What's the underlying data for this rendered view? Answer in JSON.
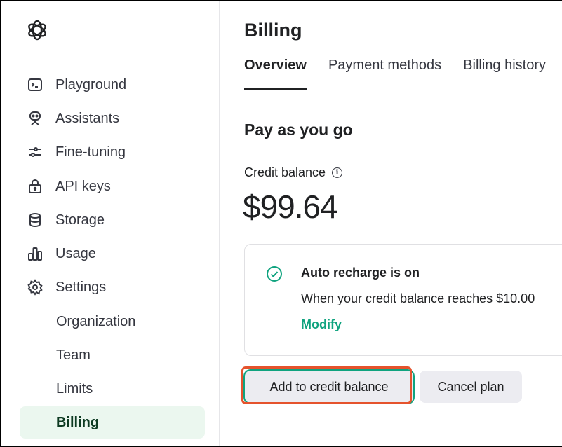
{
  "sidebar": {
    "items": [
      {
        "label": "Playground",
        "icon": "terminal-icon"
      },
      {
        "label": "Assistants",
        "icon": "robot-icon"
      },
      {
        "label": "Fine-tuning",
        "icon": "sliders-icon"
      },
      {
        "label": "API keys",
        "icon": "lock-icon"
      },
      {
        "label": "Storage",
        "icon": "database-icon"
      },
      {
        "label": "Usage",
        "icon": "bar-chart-icon"
      },
      {
        "label": "Settings",
        "icon": "gear-icon"
      }
    ],
    "sub_items": [
      {
        "label": "Organization"
      },
      {
        "label": "Team"
      },
      {
        "label": "Limits"
      },
      {
        "label": "Billing",
        "active": true
      }
    ]
  },
  "header": {
    "title": "Billing",
    "tabs": [
      {
        "label": "Overview",
        "active": true
      },
      {
        "label": "Payment methods"
      },
      {
        "label": "Billing history"
      }
    ]
  },
  "main": {
    "section_title": "Pay as you go",
    "credit_label": "Credit balance",
    "credit_value": "$99.64",
    "recharge": {
      "title": "Auto recharge is on",
      "description": "When your credit balance reaches $10.00",
      "modify_label": "Modify"
    },
    "buttons": {
      "add_credit": "Add to credit balance",
      "cancel_plan": "Cancel plan"
    }
  },
  "colors": {
    "accent": "#10a37f",
    "active_nav_bg": "#ebf7ef",
    "highlight": "#e5532d"
  }
}
